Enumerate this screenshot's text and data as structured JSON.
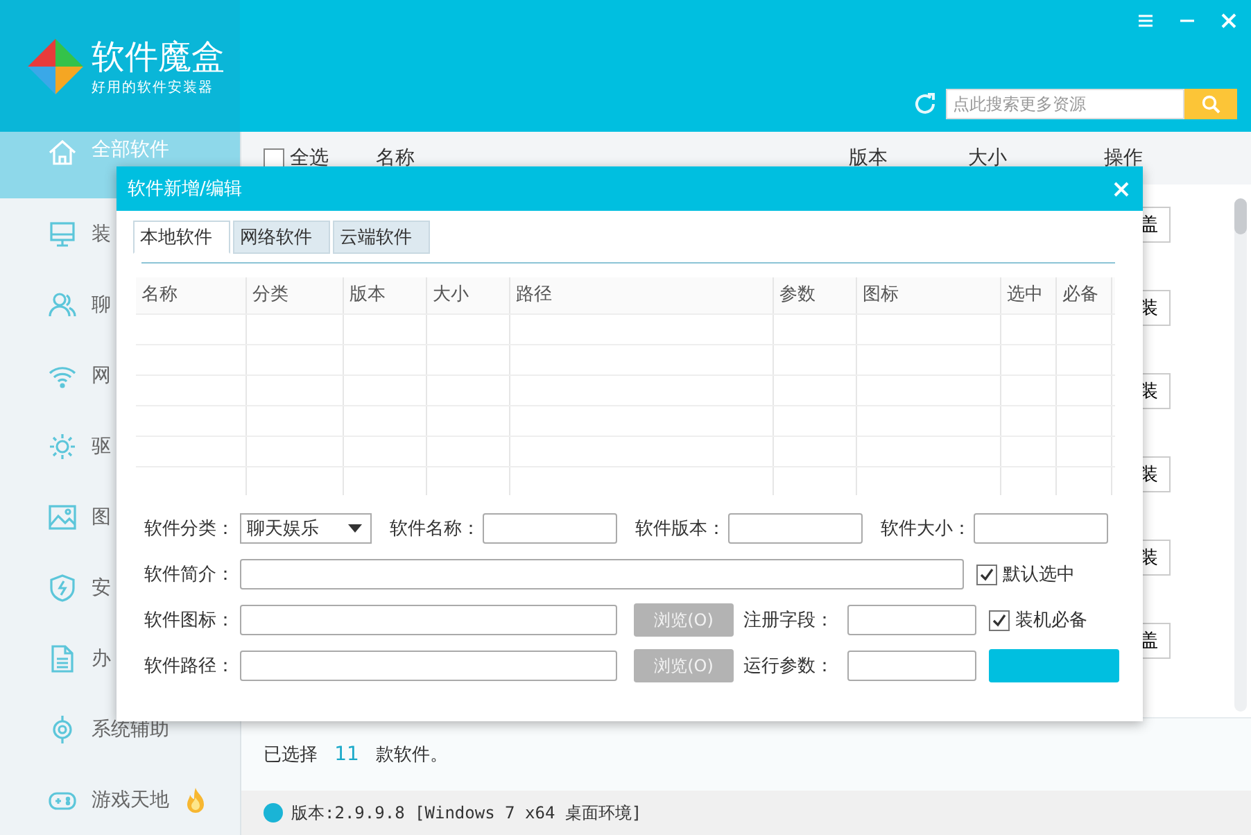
{
  "app": {
    "title": "软件魔盒",
    "subtitle": "好用的软件安装器"
  },
  "search": {
    "placeholder": "点此搜索更多资源"
  },
  "sidebar": {
    "items": [
      {
        "label": "全部软件",
        "selected": true,
        "hot": false
      },
      {
        "label": "装",
        "selected": false,
        "hot": false
      },
      {
        "label": "聊",
        "selected": false,
        "hot": false
      },
      {
        "label": "网",
        "selected": false,
        "hot": false
      },
      {
        "label": "驱",
        "selected": false,
        "hot": false
      },
      {
        "label": "图",
        "selected": false,
        "hot": false
      },
      {
        "label": "安",
        "selected": false,
        "hot": false
      },
      {
        "label": "办",
        "selected": false,
        "hot": false
      },
      {
        "label": "系统辅助",
        "selected": false,
        "hot": false
      },
      {
        "label": "游戏天地",
        "selected": false,
        "hot": true
      }
    ]
  },
  "list": {
    "select_all": {
      "label": "全选",
      "checked": false
    },
    "columns": [
      "名称",
      "版本",
      "大小",
      "操作"
    ],
    "row_buttons": [
      "盖",
      "装",
      "装",
      "装",
      "装",
      "盖"
    ]
  },
  "summary": {
    "prefix": "已选择",
    "count": "11",
    "suffix": "款软件。"
  },
  "status_bar": {
    "version": "版本:2.9.9.8 [Windows 7 x64 桌面环境]"
  },
  "dialog": {
    "title": "软件新增/编辑",
    "tabs": [
      {
        "label": "本地软件",
        "selected": true
      },
      {
        "label": "网络软件",
        "selected": false
      },
      {
        "label": "云端软件",
        "selected": false
      }
    ],
    "table": {
      "columns": [
        "名称",
        "分类",
        "版本",
        "大小",
        "路径",
        "参数",
        "图标",
        "选中",
        "必备"
      ]
    },
    "form": {
      "category": {
        "label": "软件分类：",
        "value": "聊天娱乐"
      },
      "name": {
        "label": "软件名称："
      },
      "version": {
        "label": "软件版本："
      },
      "size": {
        "label": "软件大小："
      },
      "description": {
        "label": "软件简介："
      },
      "default_selected": {
        "label": "默认选中",
        "checked": true
      },
      "icon": {
        "label": "软件图标：",
        "browse": "浏览(O)"
      },
      "reg_field": {
        "label": "注册字段："
      },
      "essential": {
        "label": "装机必备",
        "checked": true
      },
      "path": {
        "label": "软件路径：",
        "browse": "浏览(O)"
      },
      "run_args": {
        "label": "运行参数："
      }
    }
  }
}
